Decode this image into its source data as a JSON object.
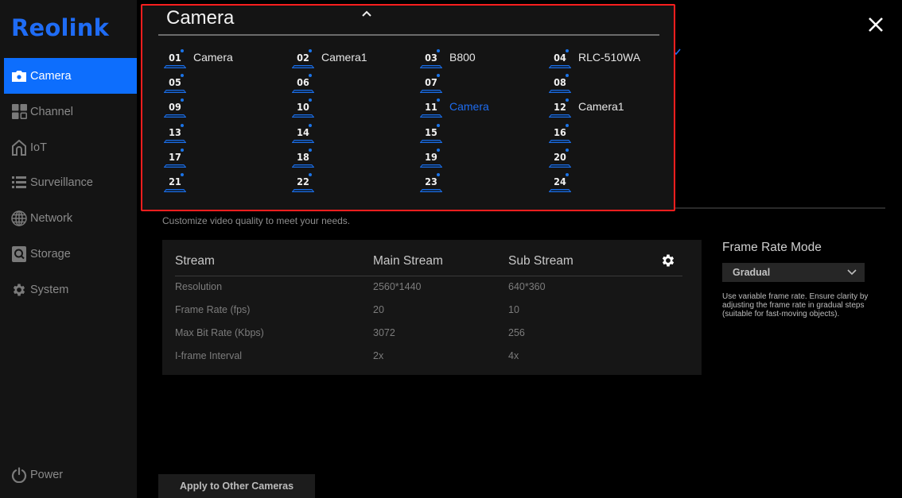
{
  "brand": {
    "logo": "Reolink",
    "accent": "#0d6efd"
  },
  "sidebar": {
    "items": [
      {
        "label": "Camera",
        "icon": "camera-icon",
        "active": true
      },
      {
        "label": "Channel",
        "icon": "grid-icon",
        "active": false
      },
      {
        "label": "IoT",
        "icon": "home-icon",
        "active": false
      },
      {
        "label": "Surveillance",
        "icon": "list-icon",
        "active": false
      },
      {
        "label": "Network",
        "icon": "globe-icon",
        "active": false
      },
      {
        "label": "Storage",
        "icon": "hdd-icon",
        "active": false
      },
      {
        "label": "System",
        "icon": "gear-icon",
        "active": false
      }
    ],
    "power": {
      "label": "Power",
      "icon": "power-icon"
    }
  },
  "camera_dropdown": {
    "title": "Camera",
    "expanded": true,
    "channels": [
      {
        "num": "01",
        "name": "Camera"
      },
      {
        "num": "02",
        "name": "Camera1"
      },
      {
        "num": "03",
        "name": "B800"
      },
      {
        "num": "04",
        "name": "RLC-510WA"
      },
      {
        "num": "05",
        "name": ""
      },
      {
        "num": "06",
        "name": ""
      },
      {
        "num": "07",
        "name": ""
      },
      {
        "num": "08",
        "name": ""
      },
      {
        "num": "09",
        "name": ""
      },
      {
        "num": "10",
        "name": ""
      },
      {
        "num": "11",
        "name": "Camera",
        "selected": true
      },
      {
        "num": "12",
        "name": "Camera1"
      },
      {
        "num": "13",
        "name": ""
      },
      {
        "num": "14",
        "name": ""
      },
      {
        "num": "15",
        "name": ""
      },
      {
        "num": "16",
        "name": ""
      },
      {
        "num": "17",
        "name": ""
      },
      {
        "num": "18",
        "name": ""
      },
      {
        "num": "19",
        "name": ""
      },
      {
        "num": "20",
        "name": ""
      },
      {
        "num": "21",
        "name": ""
      },
      {
        "num": "22",
        "name": ""
      },
      {
        "num": "23",
        "name": ""
      },
      {
        "num": "24",
        "name": ""
      }
    ]
  },
  "description": "Customize video quality to meet your needs.",
  "stream_table": {
    "headers": [
      "Stream",
      "Main Stream",
      "Sub Stream"
    ],
    "rows": [
      {
        "label": "Resolution",
        "main": "2560*1440",
        "sub": "640*360"
      },
      {
        "label": "Frame Rate (fps)",
        "main": "20",
        "sub": "10"
      },
      {
        "label": "Max Bit Rate (Kbps)",
        "main": "3072",
        "sub": "256"
      },
      {
        "label": "I-frame Interval",
        "main": "2x",
        "sub": "4x"
      }
    ]
  },
  "frame_rate_mode": {
    "label": "Frame Rate Mode",
    "selected": "Gradual",
    "help": "Use variable frame rate. Ensure clarity by adjusting the frame rate in gradual steps (suitable for fast-moving objects)."
  },
  "apply_button": "Apply to Other Cameras"
}
